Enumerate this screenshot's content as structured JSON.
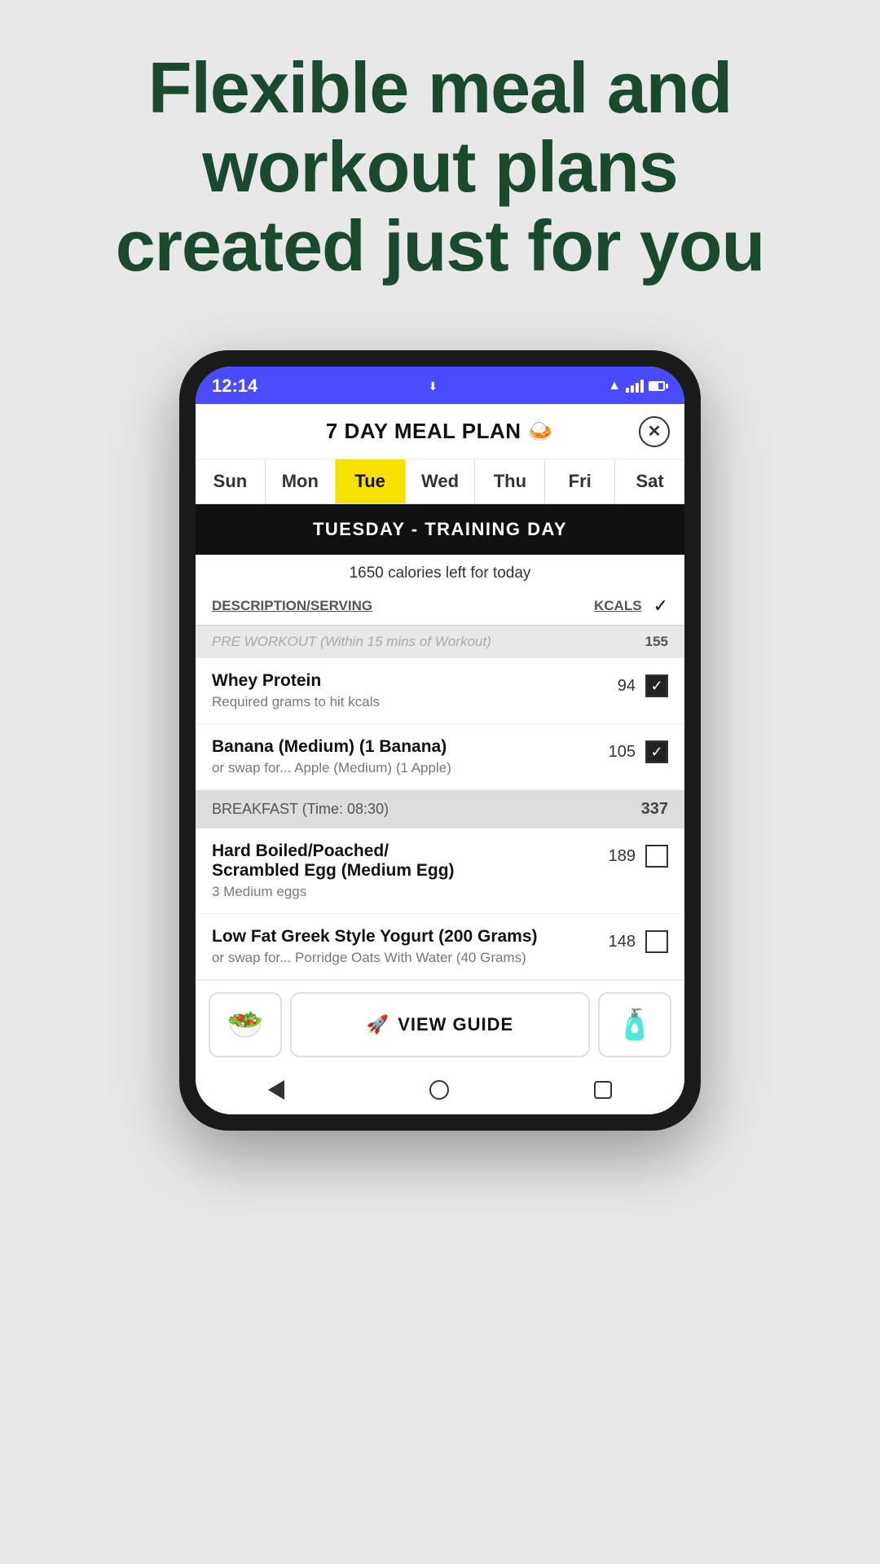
{
  "headline": {
    "line1": "Flexible meal and",
    "line2": "workout plans",
    "line3": "created just for you"
  },
  "status_bar": {
    "time": "12:14",
    "wifi": "▲",
    "signal": "▲",
    "battery": ""
  },
  "app": {
    "title": "7 DAY MEAL PLAN",
    "emoji": "🍛",
    "close_label": "✕",
    "days": [
      {
        "label": "Sun",
        "active": false
      },
      {
        "label": "Mon",
        "active": false
      },
      {
        "label": "Tue",
        "active": true
      },
      {
        "label": "Wed",
        "active": false
      },
      {
        "label": "Thu",
        "active": false
      },
      {
        "label": "Fri",
        "active": false
      },
      {
        "label": "Sat",
        "active": false
      }
    ],
    "banner": "TUESDAY  -  TRAINING DAY",
    "calories_text": "1650 calories left for today",
    "table_header": {
      "desc": "DESCRIPTION/SERVING",
      "kcals": "KCALS"
    },
    "sections": [
      {
        "type": "partial",
        "text": "PRE WORKOUT (Within 15 mins of Workout)",
        "kcals": "155"
      },
      {
        "type": "food",
        "name": "Whey Protein",
        "desc": "Required grams to hit kcals",
        "kcals": "94",
        "checked": true
      },
      {
        "type": "food",
        "name": "Banana (Medium) (1 Banana)",
        "desc": "or swap for... Apple (Medium) (1 Apple)",
        "kcals": "105",
        "checked": true
      },
      {
        "type": "section",
        "label": "BREAKFAST (Time: 08:30)",
        "kcals": "337"
      },
      {
        "type": "food",
        "name": "Hard Boiled/Poached/Scrambled Egg (Medium Egg)",
        "desc": "3 Medium eggs",
        "kcals": "189",
        "checked": false
      },
      {
        "type": "food",
        "name": "Low Fat Greek Style Yogurt (200 Grams)",
        "desc": "or swap for... Porridge Oats With Water (40 Grams)",
        "kcals": "148",
        "checked": false
      }
    ],
    "bottom_buttons": {
      "left_icon": "🥗",
      "main_label": "VIEW GUIDE",
      "main_icon": "🚀",
      "right_icon": "🧴"
    }
  }
}
